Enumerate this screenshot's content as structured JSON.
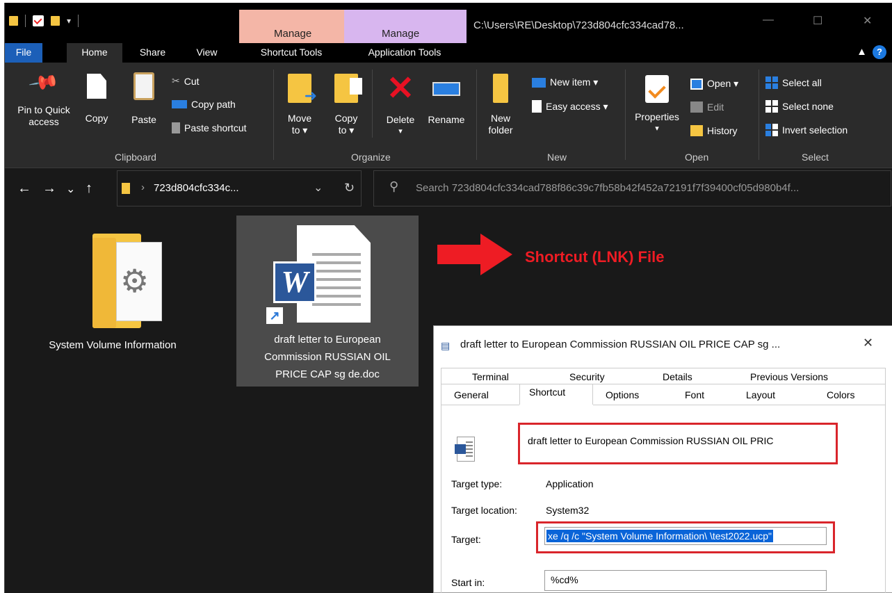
{
  "titlebar": {
    "manage_label_1": "Manage",
    "manage_label_2": "Manage",
    "window_title": "C:\\Users\\RE\\Desktop\\723d804cfc334cad78...",
    "minimize_icon": "minimize-icon",
    "maximize_icon": "maximize-icon",
    "close_icon": "close-icon",
    "manage1_color": "#f4b6a7",
    "manage2_color": "#d8b6ef"
  },
  "tabs": {
    "file": "File",
    "home": "Home",
    "share": "Share",
    "view": "View",
    "shortcut_tools": "Shortcut Tools",
    "application_tools": "Application Tools",
    "collapse": "^",
    "help": "?"
  },
  "ribbon": {
    "clipboard": {
      "pin_line1": "Pin to Quick",
      "pin_line2": "access",
      "copy": "Copy",
      "paste": "Paste",
      "cut": "Cut",
      "copy_path": "Copy path",
      "paste_shortcut": "Paste shortcut",
      "label": "Clipboard"
    },
    "organize": {
      "move_line1": "Move",
      "move_line2": "to ▾",
      "copy_line1": "Copy",
      "copy_line2": "to ▾",
      "delete": "Delete",
      "delete_arrow": "▾",
      "rename": "Rename",
      "label": "Organize"
    },
    "new": {
      "folder_line1": "New",
      "folder_line2": "folder",
      "new_item": "New item ▾",
      "easy_access": "Easy access ▾",
      "label": "New"
    },
    "open": {
      "properties": "Properties",
      "properties_arrow": "▾",
      "open": "Open ▾",
      "edit": "Edit",
      "history": "History",
      "label": "Open"
    },
    "select": {
      "select_all": "Select all",
      "select_none": "Select none",
      "invert_selection": "Invert selection",
      "label": "Select"
    }
  },
  "nav": {
    "back": "←",
    "forward": "→",
    "recent": "⌄",
    "up": "↑",
    "address": "723d804cfc334c...",
    "address_sep": "›",
    "address_dropdown": "⌄",
    "refresh": "↻",
    "search_placeholder": "Search 723d804cfc334cad788f86c39c7fb58b42f452a72191f7f39400cf05d980b4f..."
  },
  "files": [
    {
      "name": "System Volume Information",
      "icon": "folder-gear-icon"
    },
    {
      "name_line1": "draft letter to European",
      "name_line2": "Commission RUSSIAN OIL",
      "name_line3": "PRICE CAP sg de.doc",
      "icon": "word-shortcut-icon"
    }
  ],
  "callout": {
    "text": "Shortcut (LNK) File",
    "color": "#ef1c24"
  },
  "dialog": {
    "title": "draft letter to European Commission RUSSIAN OIL PRICE CAP sg ...",
    "close": "✕",
    "tabs_row1": [
      "Terminal",
      "Security",
      "Details",
      "Previous Versions"
    ],
    "tabs_row2": [
      "General",
      "Shortcut",
      "Options",
      "Font",
      "Layout",
      "Colors"
    ],
    "name_value": "draft letter to European Commission RUSSIAN OIL PRIC",
    "target_type_label": "Target type:",
    "target_type_value": "Application",
    "target_location_label": "Target location:",
    "target_location_value": "System32",
    "target_label": "Target:",
    "target_value": "xe /q /c \"System Volume Information\\  \\test2022.ucp\"",
    "start_in_label": "Start in:",
    "start_in_value": "%cd%",
    "highlight_color": "#d9252b"
  }
}
